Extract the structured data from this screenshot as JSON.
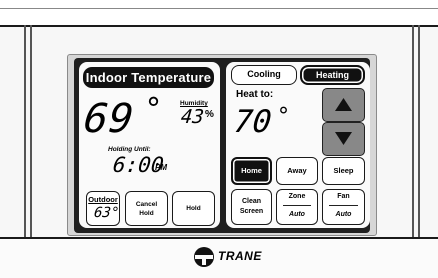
{
  "indoor": {
    "title": "Indoor Temperature",
    "temperature": "69",
    "degree": "°",
    "humidity_label": "Humidity",
    "humidity_value": "43",
    "humidity_unit": "%",
    "holding_label": "Holding Until:",
    "holding_time": "6:00",
    "holding_ampm": "PM"
  },
  "outdoor": {
    "label": "Outdoor",
    "value": "63°"
  },
  "buttons": {
    "cancel_hold": "Cancel Hold",
    "hold": "Hold",
    "cooling": "Cooling",
    "heating": "Heating",
    "home": "Home",
    "away": "Away",
    "sleep": "Sleep",
    "clean_screen": "Clean Screen"
  },
  "setpoint": {
    "label": "Heat to:",
    "value": "70",
    "degree": "°"
  },
  "zone": {
    "label": "Zone",
    "value": "Auto"
  },
  "fan": {
    "label": "Fan",
    "value": "Auto"
  },
  "brand": {
    "name": "TRANE"
  },
  "colors": {
    "active_button": "#111111",
    "arrow_button": "#888888",
    "screen_border": "#1f1f1f"
  },
  "icons": {
    "up": "triangle-up-icon",
    "down": "triangle-down-icon",
    "logo": "trane-logo-icon"
  }
}
